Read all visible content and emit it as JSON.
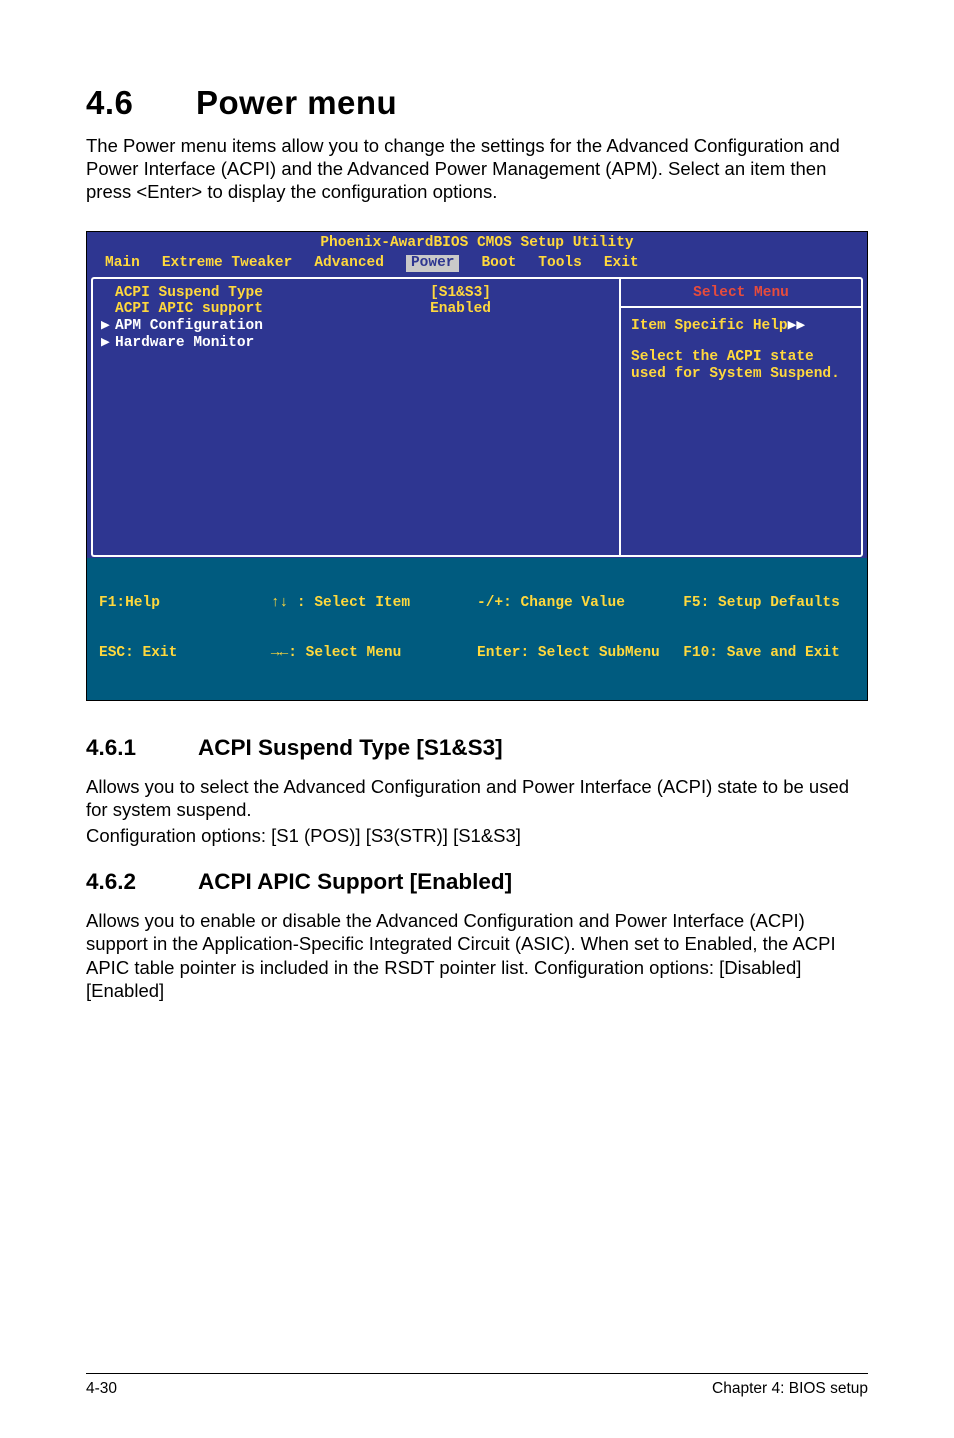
{
  "section": {
    "num": "4.6",
    "title": "Power menu"
  },
  "intro": "The Power menu items allow you to change the settings for the Advanced Configuration and Power Interface (ACPI) and the Advanced Power Management (APM). Select an item then press <Enter> to display the configuration options.",
  "bios": {
    "title": "Phoenix-AwardBIOS CMOS Setup Utility",
    "menus": [
      "Main",
      "Extreme Tweaker",
      "Advanced",
      "Power",
      "Boot",
      "Tools",
      "Exit"
    ],
    "selected_menu": "Power",
    "items": [
      {
        "label": "ACPI Suspend Type",
        "value": "[S1&S3]",
        "submenu": false,
        "highlight": true
      },
      {
        "label": "ACPI APIC support",
        "value": "Enabled",
        "submenu": false,
        "highlight": true
      },
      {
        "label": "APM Configuration",
        "value": "",
        "submenu": true,
        "highlight": false
      },
      {
        "label": "Hardware Monitor",
        "value": "",
        "submenu": true,
        "highlight": false
      }
    ],
    "help": {
      "title": "Select Menu",
      "line1": "Item Specific Help",
      "body": "Select the ACPI state used for System Suspend."
    },
    "legend": {
      "f1": "F1:Help",
      "esc": "ESC: Exit",
      "sel_item": "↑↓ : Select Item",
      "sel_menu": "→←: Select Menu",
      "change": "-/+: Change Value",
      "enter": "Enter: Select SubMenu",
      "f5": "F5: Setup Defaults",
      "f10": "F10: Save and Exit"
    }
  },
  "sub1": {
    "num": "4.6.1",
    "title": "ACPI Suspend Type [S1&S3]",
    "p1": "Allows you to select the Advanced Configuration and Power Interface (ACPI) state to be used for system suspend.",
    "p2": "Configuration options: [S1 (POS)] [S3(STR)] [S1&S3]"
  },
  "sub2": {
    "num": "4.6.2",
    "title": "ACPI APIC Support [Enabled]",
    "p1": "Allows you to enable or disable the Advanced Configuration and Power Interface (ACPI) support in the Application-Specific Integrated Circuit (ASIC). When set to Enabled, the ACPI APIC table pointer is included in the RSDT pointer list. Configuration options: [Disabled] [Enabled]"
  },
  "footer": {
    "left": "4-30",
    "right": "Chapter 4: BIOS setup"
  }
}
